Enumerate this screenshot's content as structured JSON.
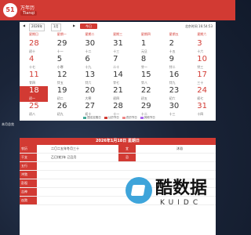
{
  "header": {
    "logo": "51",
    "title": "万年历",
    "subtitle": "Tianqi"
  },
  "controls": {
    "year": "2026年",
    "month": "1月",
    "today_label": "今日",
    "clock": "北京时间 16:54:53"
  },
  "weekdays": [
    "星期日",
    "星期一",
    "星期二",
    "星期三",
    "星期四",
    "星期五",
    "星期六"
  ],
  "days": [
    {
      "d": "28",
      "l": "初十"
    },
    {
      "d": "29",
      "l": "十一"
    },
    {
      "d": "30",
      "l": "十二"
    },
    {
      "d": "31",
      "l": "十三"
    },
    {
      "d": "1",
      "l": "元旦"
    },
    {
      "d": "2",
      "l": "十五"
    },
    {
      "d": "3",
      "l": "十六"
    },
    {
      "d": "4",
      "l": "十七"
    },
    {
      "d": "5",
      "l": "小寒"
    },
    {
      "d": "6",
      "l": "十九"
    },
    {
      "d": "7",
      "l": "二十"
    },
    {
      "d": "8",
      "l": "廿一"
    },
    {
      "d": "9",
      "l": "廿二"
    },
    {
      "d": "10",
      "l": "廿三"
    },
    {
      "d": "11",
      "l": "廿四"
    },
    {
      "d": "12",
      "l": "廿五"
    },
    {
      "d": "13",
      "l": "廿六"
    },
    {
      "d": "14",
      "l": "廿七"
    },
    {
      "d": "15",
      "l": "廿八"
    },
    {
      "d": "16",
      "l": "廿九"
    },
    {
      "d": "17",
      "l": "三十"
    },
    {
      "d": "18",
      "l": "初一"
    },
    {
      "d": "19",
      "l": "初二"
    },
    {
      "d": "20",
      "l": "大寒"
    },
    {
      "d": "21",
      "l": "初四"
    },
    {
      "d": "22",
      "l": "初五"
    },
    {
      "d": "23",
      "l": "初六"
    },
    {
      "d": "24",
      "l": "初七"
    },
    {
      "d": "25",
      "l": "初八"
    },
    {
      "d": "26",
      "l": "初九"
    },
    {
      "d": "27",
      "l": "初十"
    },
    {
      "d": "28",
      "l": "十一"
    },
    {
      "d": "29",
      "l": "十二"
    },
    {
      "d": "30",
      "l": "十三"
    },
    {
      "d": "31",
      "l": "十四"
    }
  ],
  "legend": [
    "国法定假日",
    "公历节日",
    "农历节日",
    "其他节日"
  ],
  "section_label": "本月总览",
  "info": {
    "title": "2026年1月18日 星期日",
    "rows": [
      {
        "k": "农历",
        "v": "二〇二五年冬月三十",
        "k2": "宜",
        "v2": "沐浴"
      },
      {
        "k": "干支",
        "v": "乙巳(蛇)年 己丑月",
        "k2": "忌",
        "v2": ""
      },
      {
        "k": "五行",
        "v": "",
        "k2": "",
        "v2": ""
      },
      {
        "k": "冲煞",
        "v": "",
        "k2": "",
        "v2": ""
      },
      {
        "k": "彭祖",
        "v": "",
        "k2": "",
        "v2": ""
      },
      {
        "k": "吉神",
        "v": "",
        "k2": "",
        "v2": ""
      },
      {
        "k": "凶煞",
        "v": "",
        "k2": "",
        "v2": ""
      }
    ]
  },
  "watermark": {
    "text": "酷数据",
    "sub": "KUIDC"
  }
}
